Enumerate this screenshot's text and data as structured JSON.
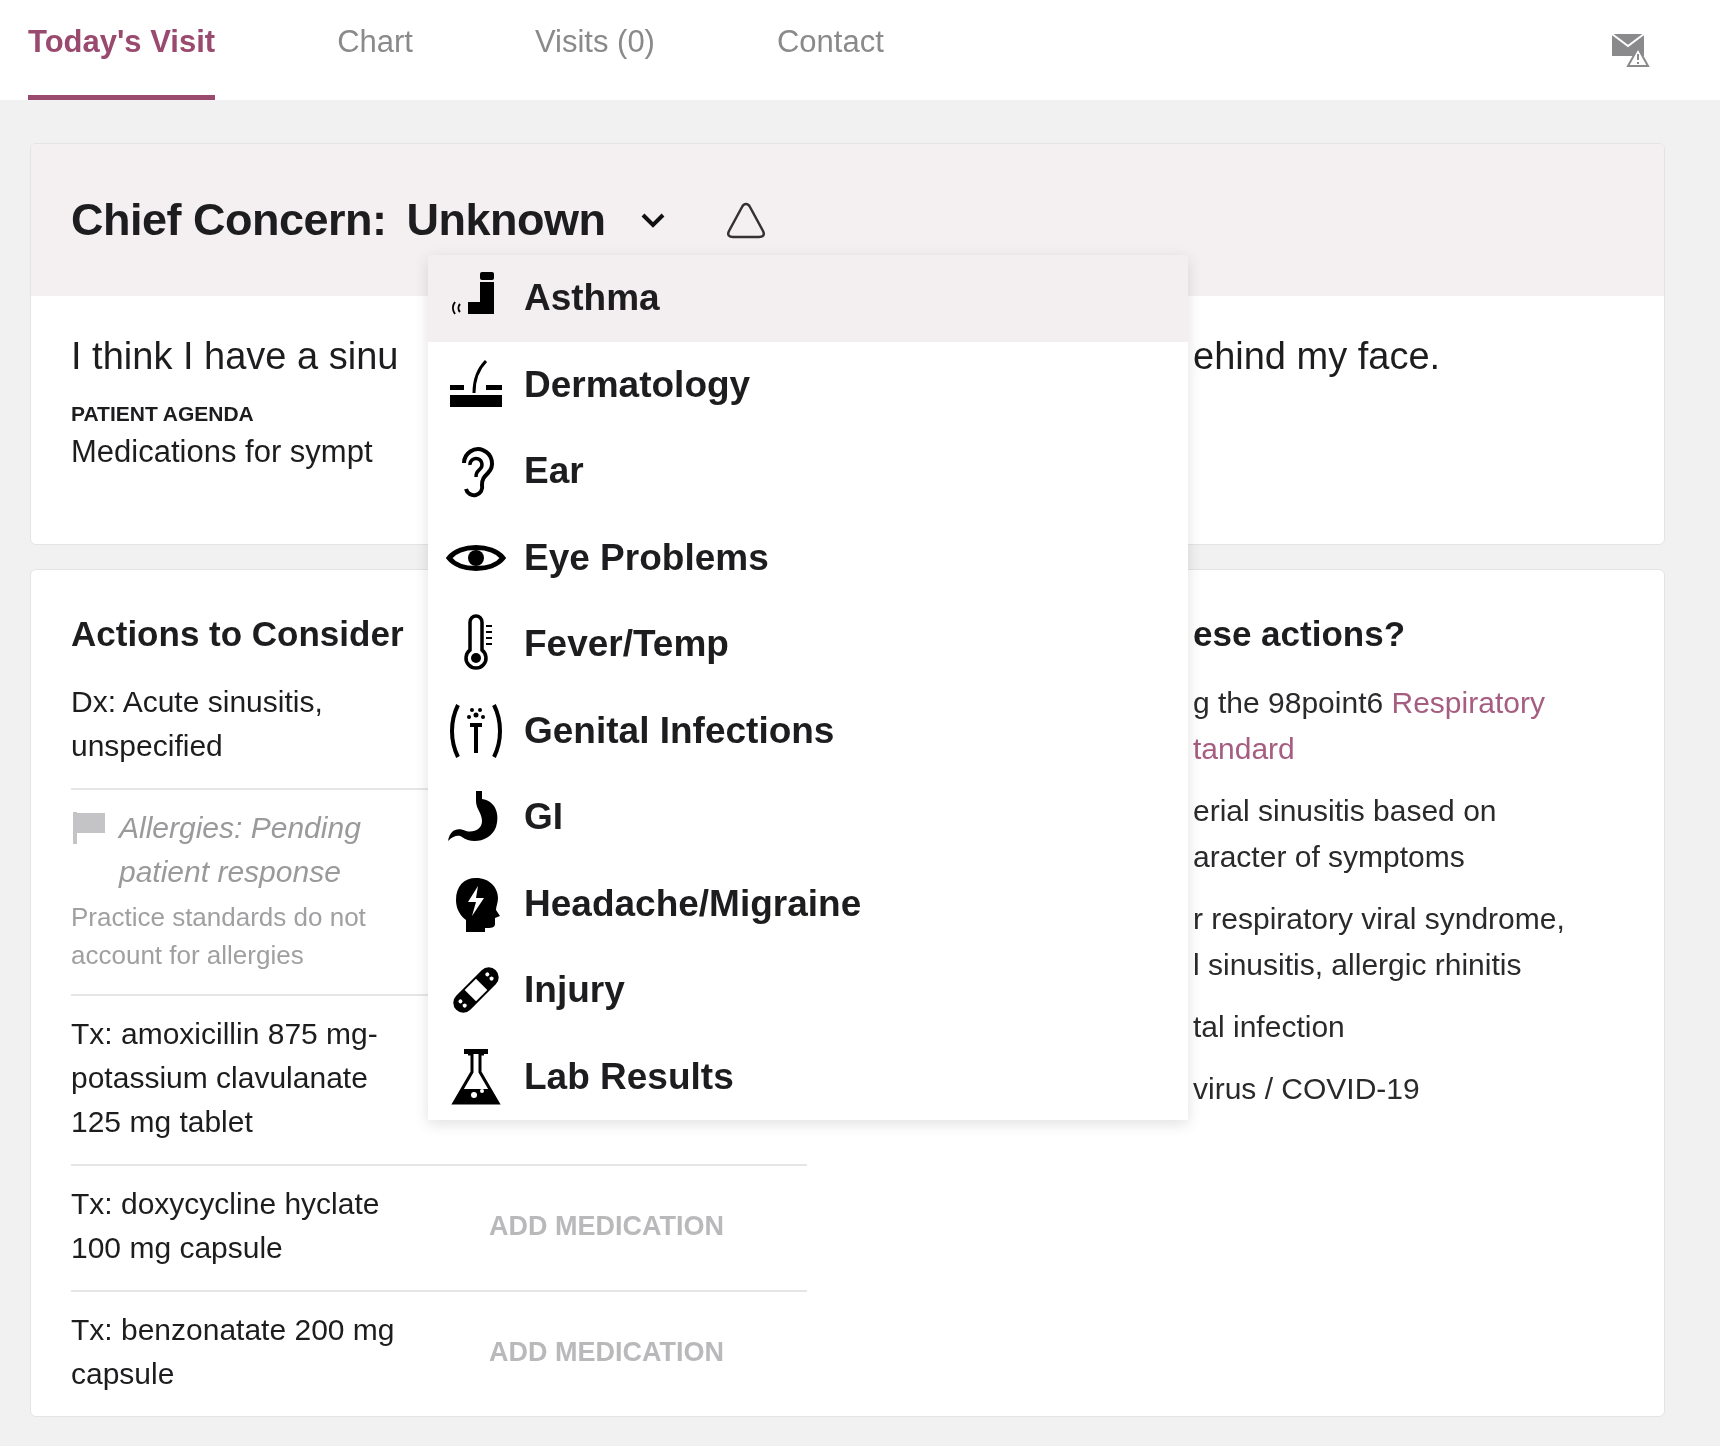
{
  "tabs": [
    {
      "label": "Today's Visit",
      "selected": true
    },
    {
      "label": "Chart",
      "selected": false
    },
    {
      "label": "Visits (0)",
      "selected": false
    },
    {
      "label": "Contact",
      "selected": false
    }
  ],
  "chief_concern": {
    "label": "Chief Concern:",
    "value": "Unknown",
    "expanded": true
  },
  "concern_menu": [
    {
      "label": "Asthma",
      "selected": true
    },
    {
      "label": "Dermatology",
      "selected": false
    },
    {
      "label": "Ear",
      "selected": false
    },
    {
      "label": "Eye Problems",
      "selected": false
    },
    {
      "label": "Fever/Temp",
      "selected": false
    },
    {
      "label": "Genital Infections",
      "selected": false
    },
    {
      "label": "GI",
      "selected": false
    },
    {
      "label": "Headache/Migraine",
      "selected": false
    },
    {
      "label": "Injury",
      "selected": false
    },
    {
      "label": "Lab Results",
      "selected": false
    }
  ],
  "complaint": {
    "left": "I think I have a sinu",
    "right": "ehind my face."
  },
  "patient_agenda": {
    "heading": "PATIENT AGENDA",
    "text": "Medications for sympt"
  },
  "actions": {
    "heading": "Actions to Consider",
    "rows": [
      {
        "kind": "dx",
        "text": "Dx: Acute sinusitis, unspecified"
      },
      {
        "kind": "allergy",
        "text": "Allergies: Pending patient response",
        "note": "Practice standards do not account for allergies"
      },
      {
        "kind": "tx",
        "text": "Tx: amoxicillin 875 mg-potassium clavulanate 125 mg tablet"
      },
      {
        "kind": "tx",
        "text": "Tx: doxycycline hyclate 100 mg capsule",
        "action": "ADD MEDICATION"
      },
      {
        "kind": "tx",
        "text": "Tx: benzonatate 200 mg capsule",
        "action": "ADD MEDICATION"
      }
    ]
  },
  "rationale": {
    "heading": "ese actions?",
    "paragraphs": [
      [
        {
          "text": "g the 98point6",
          "link": "Respiratory"
        },
        {
          "link": "tandard"
        }
      ],
      [
        {
          "text": "erial sinusitis based on"
        },
        {
          "text": "aracter of symptoms"
        }
      ],
      [
        {
          "text": "r respiratory viral syndrome,"
        },
        {
          "text": "l sinusitis, allergic rhinitis"
        }
      ],
      [
        {
          "text": "tal infection"
        }
      ],
      [
        {
          "text": "virus / COVID-19"
        }
      ]
    ]
  }
}
